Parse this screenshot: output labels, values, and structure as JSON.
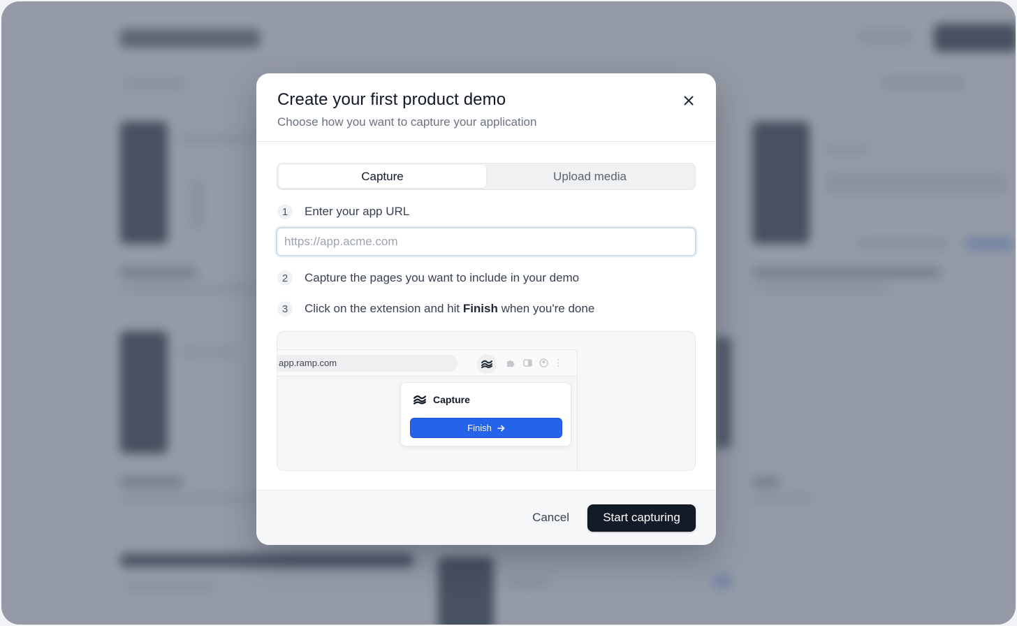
{
  "background": {
    "description_free": true
  },
  "modal": {
    "title": "Create your first product demo",
    "subtitle": "Choose how you want to capture your application",
    "close_icon": "close-icon"
  },
  "tabs": [
    {
      "label": "Capture",
      "active": true
    },
    {
      "label": "Upload media",
      "active": false
    }
  ],
  "steps": {
    "s1": {
      "num": "1",
      "text": "Enter your app URL"
    },
    "s2": {
      "num": "2",
      "text": "Capture the pages you want to include in your demo"
    },
    "s3": {
      "num": "3",
      "text_before": "Click on the extension and hit ",
      "text_bold": "Finish",
      "text_after": " when you're done"
    }
  },
  "url_input": {
    "value": "",
    "placeholder": "https://app.acme.com"
  },
  "illustration": {
    "address": "app.ramp.com",
    "popup_title": "Capture",
    "finish_label": "Finish",
    "finish_color": "#2563eb",
    "icons": [
      "extension-logo-icon",
      "puzzle-icon",
      "sidebar-icon",
      "profile-icon",
      "more-icon"
    ]
  },
  "footer": {
    "cancel_label": "Cancel",
    "primary_label": "Start capturing",
    "primary_color": "#131b28"
  }
}
